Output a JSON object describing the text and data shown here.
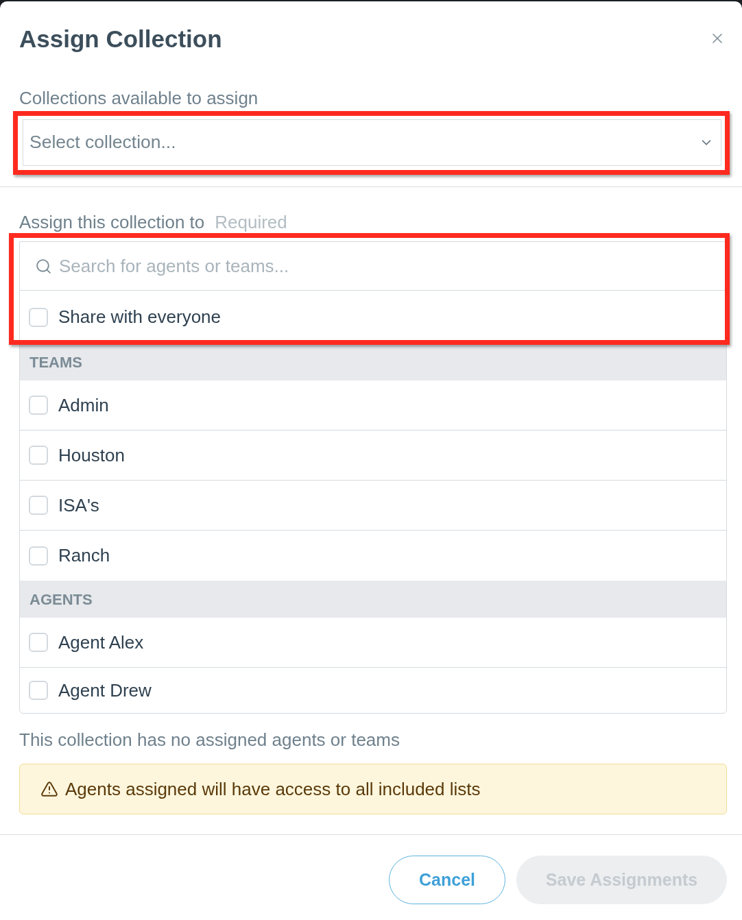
{
  "dialog": {
    "title": "Assign Collection"
  },
  "collection_field": {
    "label": "Collections available to assign",
    "placeholder": "Select collection...",
    "highlighted": true
  },
  "assign_field": {
    "label": "Assign this collection to",
    "required_label": "Required",
    "highlighted": true,
    "search": {
      "placeholder": "Search for agents or teams..."
    },
    "share_everyone": {
      "label": "Share with everyone",
      "checked": false
    }
  },
  "groups": [
    {
      "heading": "TEAMS",
      "items": [
        {
          "label": "Admin",
          "checked": false
        },
        {
          "label": "Houston",
          "checked": false
        },
        {
          "label": "ISA's",
          "checked": false
        },
        {
          "label": "Ranch",
          "checked": false
        }
      ]
    },
    {
      "heading": "AGENTS",
      "items": [
        {
          "label": "Agent Alex",
          "checked": false
        },
        {
          "label": "Agent Drew",
          "checked": false
        }
      ]
    }
  ],
  "empty_note": "This collection has no assigned agents or teams",
  "warning": {
    "text": "Agents assigned will have access to all included lists"
  },
  "buttons": [
    {
      "label": "Cancel",
      "kind": "secondary",
      "disabled": false
    },
    {
      "label": "Save Assignments",
      "kind": "primary",
      "disabled": true
    }
  ]
}
